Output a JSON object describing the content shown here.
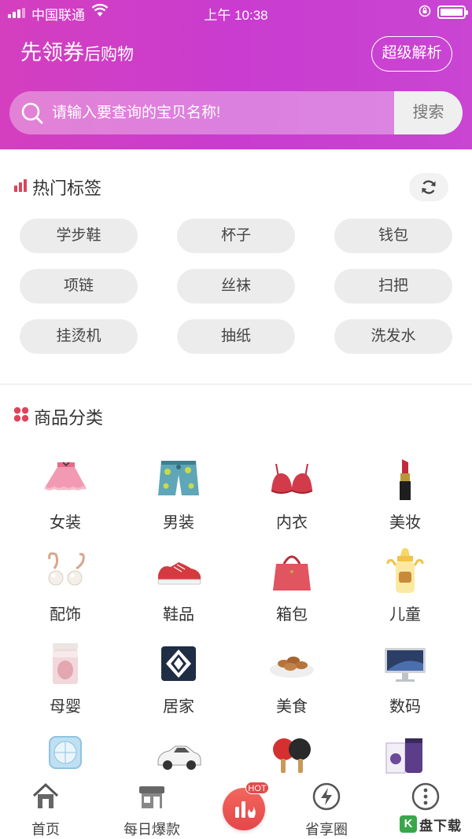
{
  "status_bar": {
    "carrier": "中国联通",
    "time": "上午 10:38"
  },
  "header": {
    "slogan_big": "先领券",
    "slogan_small": "后购物",
    "super_button": "超级解析"
  },
  "search": {
    "placeholder": "请输入要查询的宝贝名称!",
    "button": "搜索"
  },
  "hot_tags": {
    "title": "热门标签",
    "tags": [
      "学步鞋",
      "杯子",
      "钱包",
      "项链",
      "丝袜",
      "扫把",
      "挂烫机",
      "抽纸",
      "洗发水"
    ]
  },
  "categories": {
    "title": "商品分类",
    "items": [
      {
        "label": "女装",
        "icon": "skirt-icon"
      },
      {
        "label": "男装",
        "icon": "shorts-icon"
      },
      {
        "label": "内衣",
        "icon": "bra-icon"
      },
      {
        "label": "美妆",
        "icon": "lipstick-icon"
      },
      {
        "label": "配饰",
        "icon": "earrings-icon"
      },
      {
        "label": "鞋品",
        "icon": "sneaker-icon"
      },
      {
        "label": "箱包",
        "icon": "handbag-icon"
      },
      {
        "label": "儿童",
        "icon": "baby-bottle-icon"
      },
      {
        "label": "母婴",
        "icon": "milk-powder-icon"
      },
      {
        "label": "居家",
        "icon": "pillow-icon"
      },
      {
        "label": "美食",
        "icon": "nuts-icon"
      },
      {
        "label": "数码",
        "icon": "monitor-icon"
      },
      {
        "label": "",
        "icon": "fan-icon"
      },
      {
        "label": "",
        "icon": "car-icon"
      },
      {
        "label": "",
        "icon": "ping-pong-icon"
      },
      {
        "label": "",
        "icon": "supplement-icon"
      }
    ]
  },
  "tab_bar": {
    "items": [
      {
        "label": "首页",
        "icon": "home-icon"
      },
      {
        "label": "每日爆款",
        "icon": "shop-icon"
      },
      {
        "label": "",
        "icon": "hot-chart-icon"
      },
      {
        "label": "省享圈",
        "icon": "lightning-icon"
      },
      {
        "label": "",
        "icon": "more-icon"
      }
    ],
    "hot_badge": "HOT"
  },
  "watermark": {
    "text": "盘下载"
  },
  "colors": {
    "header_gradient_start": "#d43fbf",
    "header_gradient_end": "#c945d2",
    "accent_red": "#e5464a",
    "tag_bg": "#ececec"
  }
}
